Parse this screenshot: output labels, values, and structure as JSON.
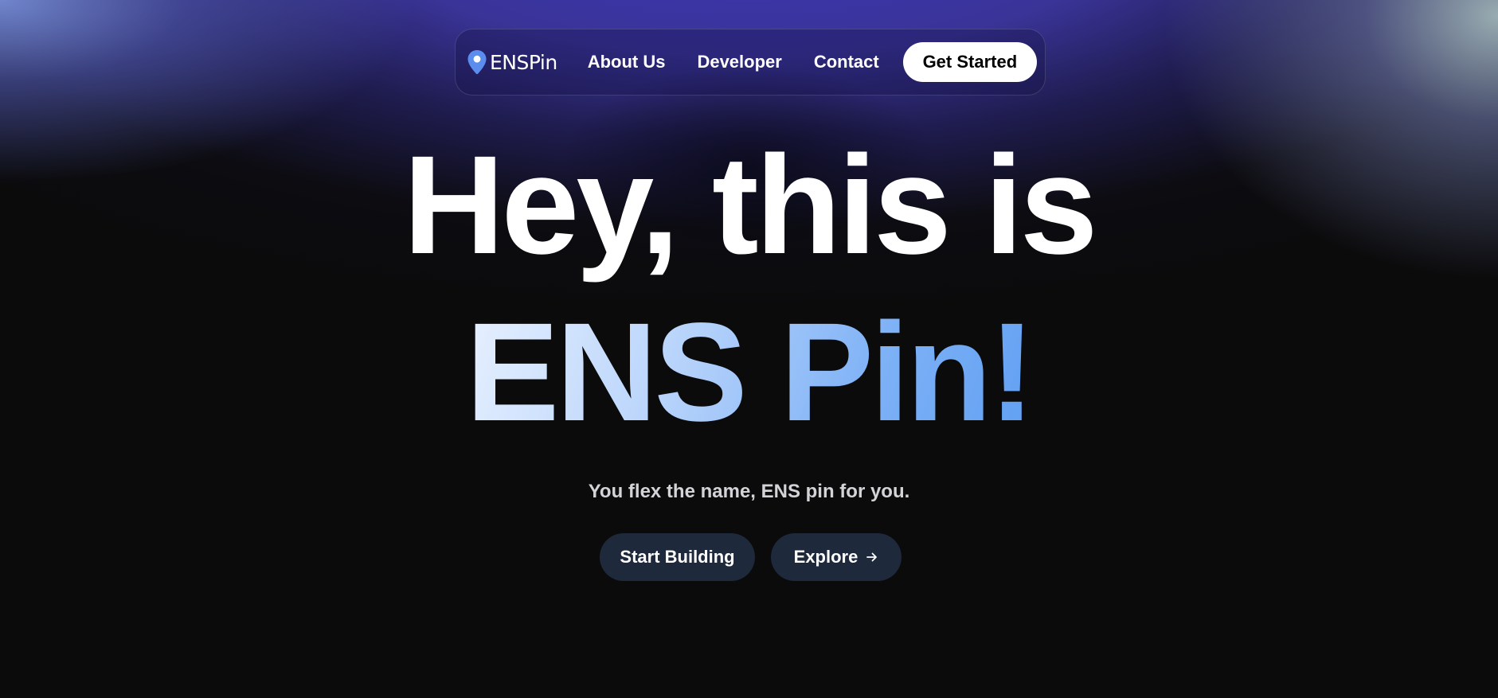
{
  "nav": {
    "logo_text": "ENSPin",
    "links": [
      "About Us",
      "Developer",
      "Contact"
    ],
    "cta_label": "Get Started"
  },
  "hero": {
    "line1": "Hey, this is",
    "line2": "ENS Pin!",
    "subtitle": "You flex the name, ENS pin for you."
  },
  "actions": {
    "start_label": "Start Building",
    "explore_label": "Explore"
  },
  "icons": {
    "logo": "map-pin-icon",
    "explore": "arrow-right-icon"
  },
  "colors": {
    "accent_blue": "#5f9ff2",
    "button_dark": "#1e293b",
    "background": "#0b0b0c"
  }
}
